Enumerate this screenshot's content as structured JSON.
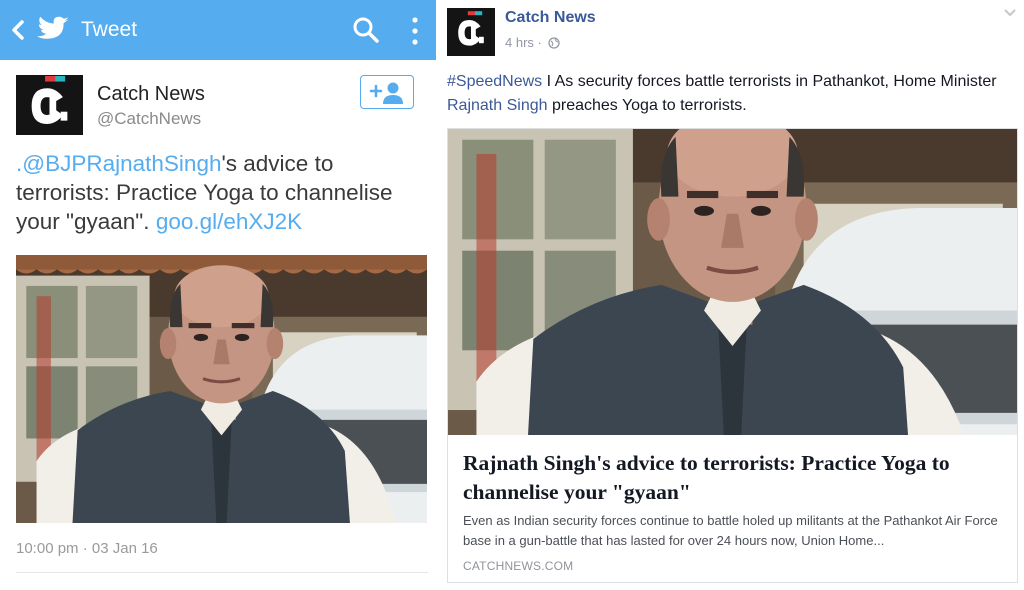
{
  "twitter": {
    "header_title": "Tweet",
    "account_name": "Catch News",
    "account_handle": "@CatchNews",
    "tweet_prefix": ".",
    "tweet_mention": "@BJPRajnathSingh",
    "tweet_body": "'s advice to terrorists: Practice Yoga to channelise your \"gyaan\". ",
    "tweet_link": "goo.gl/ehXJ2K",
    "timestamp": "10:00 pm · 03 Jan 16",
    "follow_icon": "add-user-icon"
  },
  "facebook": {
    "page_name": "Catch News",
    "post_age": "4 hrs ·",
    "privacy_icon": "globe-icon",
    "post_hashtag": "#SpeedNews",
    "post_text_1": " I As security forces battle terrorists in Pathankot, Home Minister ",
    "post_mention": "Rajnath Singh",
    "post_text_2": " preaches Yoga to terrorists.",
    "card_title": "Rajnath Singh's advice to terrorists: Practice Yoga to channelise your \"gyaan\"",
    "card_description": "Even as Indian security forces continue to battle holed up militants at the Pathankot Air Force base in a gun-battle that has lasted for over 24 hours now, Union Home...",
    "card_domain": "CATCHNEWS.COM"
  },
  "colors": {
    "twitter_blue": "#55acee",
    "facebook_blue": "#3b5998",
    "logo_red": "#e03a3e",
    "logo_teal": "#2bb3c0"
  }
}
